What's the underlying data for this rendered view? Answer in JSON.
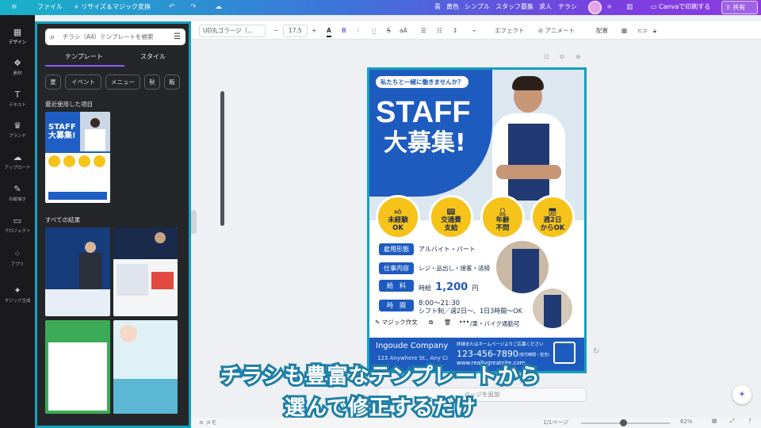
{
  "topbar": {
    "file": "ファイル",
    "resize": "+ リサイズ＆マジック変換",
    "tags": [
      "青",
      "黄色",
      "シンプル",
      "スタッフ募集",
      "求人",
      "チラシ"
    ],
    "save": "Canvaで印刷する",
    "share": "共有"
  },
  "rail": {
    "items": [
      {
        "label": "デザイン",
        "icon": "design-icon"
      },
      {
        "label": "素材",
        "icon": "elements-icon"
      },
      {
        "label": "テキスト",
        "icon": "text-icon"
      },
      {
        "label": "ブランド",
        "icon": "brand-icon"
      },
      {
        "label": "アップロード",
        "icon": "upload-icon"
      },
      {
        "label": "お絵描き",
        "icon": "draw-icon"
      },
      {
        "label": "プロジェクト",
        "icon": "folder-icon"
      },
      {
        "label": "アプリ",
        "icon": "apps-icon"
      },
      {
        "label": "マジック生成",
        "icon": "magic-icon"
      }
    ]
  },
  "panel": {
    "search_placeholder": "チラシ（A4）テンプレートを検索",
    "tabs": [
      "テンプレート",
      "スタイル"
    ],
    "chips": [
      "夏",
      "イベント",
      "メニュー",
      "秋",
      "販"
    ],
    "recent_title": "最近使用した項目",
    "all_results_title": "すべての結果"
  },
  "toolbar": {
    "font": "UD丸ゴラージ（...",
    "font_size": "17.5",
    "effects": "エフェクト",
    "animate": "アニメート",
    "position": "配置"
  },
  "flyer": {
    "bubble": "私たちと一緒に働きませんか？",
    "title1": "STAFF",
    "title2": "大募集!",
    "badges": [
      {
        "text1": "未経験",
        "text2": "OK"
      },
      {
        "text1": "交通費",
        "text2": "支給"
      },
      {
        "text1": "年齢",
        "text2": "不問"
      },
      {
        "text1": "週2日",
        "text2": "からOK"
      }
    ],
    "rows": [
      {
        "label": "雇用形態",
        "value": "アルバイト・パート"
      },
      {
        "label": "仕事内容",
        "value": "レジ・品出し・接客・清掃"
      },
      {
        "label": "給　料",
        "value_prefix": "時給",
        "value_big": "1,200",
        "value_suffix": "円"
      },
      {
        "label": "時　間",
        "value": "8:00〜21:30",
        "value2": "シフト制／週2日〜、1日3時間〜OK"
      }
    ],
    "access": "/車・バイク通勤可",
    "company": "Ingoude Company",
    "address": "123 Anywhere St., Any Ci",
    "contact_note": "詳細またはホームページよりご応募ください",
    "phone": "123-456-7890",
    "phone_note": "(受付時間・担当)",
    "web": "www.reallygreatsite.com"
  },
  "context_menu": {
    "magic": "マジック作文"
  },
  "caption": {
    "line1": "チラシも豊富なテンプレートから",
    "line2": "選んで修正するだけ"
  },
  "statusbar": {
    "memo": "メモ",
    "page": "1/1ページ",
    "zoom": "62%"
  },
  "colors": {
    "accent_blue": "#1e5bbf",
    "badge_yellow": "#f6c31a",
    "selection": "#15a0c0"
  },
  "add_page": "ページを追加"
}
